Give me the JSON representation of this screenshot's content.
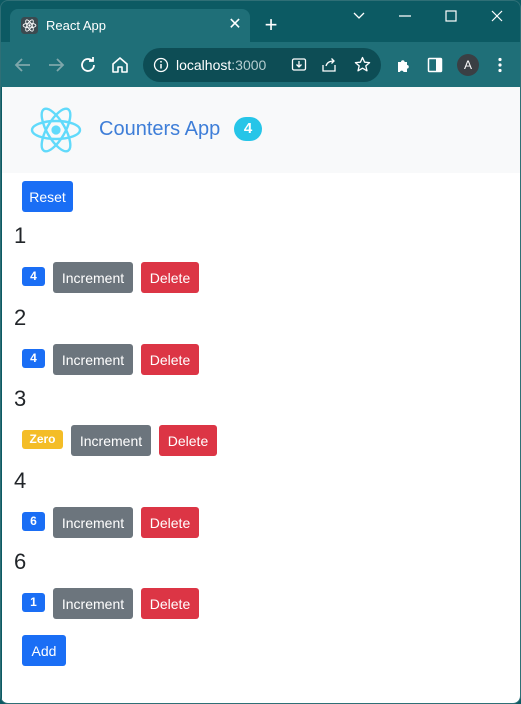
{
  "browser": {
    "tab_title": "React App",
    "url_host": "localhost",
    "url_port": ":3000",
    "avatar_letter": "A"
  },
  "navbar": {
    "brand": "Counters App",
    "count_badge": "4"
  },
  "actions": {
    "reset_label": "Reset",
    "add_label": "Add"
  },
  "counters": [
    {
      "heading": "1",
      "badge": "4",
      "badge_color": "#1a6ef5",
      "increment_label": "Increment",
      "delete_label": "Delete"
    },
    {
      "heading": "2",
      "badge": "4",
      "badge_color": "#1a6ef5",
      "increment_label": "Increment",
      "delete_label": "Delete"
    },
    {
      "heading": "3",
      "badge": "Zero",
      "badge_color": "#f4bd27",
      "increment_label": "Increment",
      "delete_label": "Delete"
    },
    {
      "heading": "4",
      "badge": "6",
      "badge_color": "#1a6ef5",
      "increment_label": "Increment",
      "delete_label": "Delete"
    },
    {
      "heading": "6",
      "badge": "1",
      "badge_color": "#1a6ef5",
      "increment_label": "Increment",
      "delete_label": "Delete"
    }
  ],
  "colors": {
    "frame": "#0c5a63",
    "toolbar": "#1f6f78",
    "primary": "#1a6ef5",
    "secondary": "#6c757d",
    "danger": "#dc3545",
    "warning": "#f4bd27",
    "info": "#26c5e8"
  }
}
